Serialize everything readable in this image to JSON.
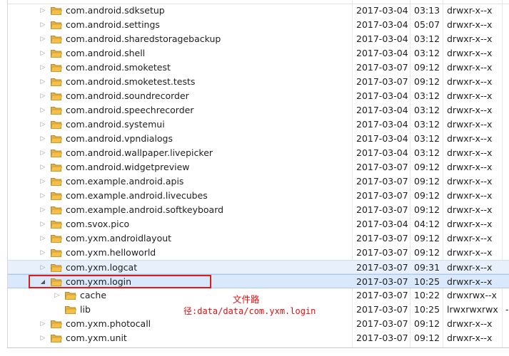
{
  "rows": [
    {
      "name": "com.android.sdksetup",
      "date": "2017-03-04",
      "time": "03:13",
      "perm": "drwxr-x--x"
    },
    {
      "name": "com.android.settings",
      "date": "2017-03-04",
      "time": "05:07",
      "perm": "drwxr-x--x"
    },
    {
      "name": "com.android.sharedstoragebackup",
      "date": "2017-03-04",
      "time": "03:12",
      "perm": "drwxr-x--x"
    },
    {
      "name": "com.android.shell",
      "date": "2017-03-04",
      "time": "03:12",
      "perm": "drwxr-x--x"
    },
    {
      "name": "com.android.smoketest",
      "date": "2017-03-07",
      "time": "09:12",
      "perm": "drwxr-x--x"
    },
    {
      "name": "com.android.smoketest.tests",
      "date": "2017-03-07",
      "time": "09:12",
      "perm": "drwxr-x--x"
    },
    {
      "name": "com.android.soundrecorder",
      "date": "2017-03-04",
      "time": "03:12",
      "perm": "drwxr-x--x"
    },
    {
      "name": "com.android.speechrecorder",
      "date": "2017-03-04",
      "time": "03:12",
      "perm": "drwxr-x--x"
    },
    {
      "name": "com.android.systemui",
      "date": "2017-03-04",
      "time": "03:12",
      "perm": "drwxr-x--x"
    },
    {
      "name": "com.android.vpndialogs",
      "date": "2017-03-04",
      "time": "03:12",
      "perm": "drwxr-x--x"
    },
    {
      "name": "com.android.wallpaper.livepicker",
      "date": "2017-03-04",
      "time": "03:12",
      "perm": "drwxr-x--x"
    },
    {
      "name": "com.android.widgetpreview",
      "date": "2017-03-07",
      "time": "09:12",
      "perm": "drwxr-x--x"
    },
    {
      "name": "com.example.android.apis",
      "date": "2017-03-07",
      "time": "09:12",
      "perm": "drwxr-x--x"
    },
    {
      "name": "com.example.android.livecubes",
      "date": "2017-03-07",
      "time": "09:12",
      "perm": "drwxr-x--x"
    },
    {
      "name": "com.example.android.softkeyboard",
      "date": "2017-03-07",
      "time": "09:12",
      "perm": "drwxr-x--x"
    },
    {
      "name": "com.svox.pico",
      "date": "2017-03-04",
      "time": "04:12",
      "perm": "drwxr-x--x"
    },
    {
      "name": "com.yxm.androidlayout",
      "date": "2017-03-07",
      "time": "09:12",
      "perm": "drwxr-x--x"
    },
    {
      "name": "com.yxm.helloworld",
      "date": "2017-03-07",
      "time": "09:12",
      "perm": "drwxr-x--x"
    },
    {
      "name": "com.yxm.logcat",
      "date": "2017-03-07",
      "time": "09:31",
      "perm": "drwxr-x--x"
    },
    {
      "name": "com.yxm.login",
      "date": "2017-03-07",
      "time": "10:25",
      "perm": "drwxr-x--x"
    },
    {
      "name": "cache",
      "date": "2017-03-07",
      "time": "10:22",
      "perm": "drwxrwx--x"
    },
    {
      "name": "lib",
      "date": "2017-03-07",
      "time": "10:25",
      "perm": "lrwxrwxrwx",
      "extra": "-"
    },
    {
      "name": "com.yxm.photocall",
      "date": "2017-03-07",
      "time": "09:12",
      "perm": "drwxr-x--x"
    },
    {
      "name": "com.yxm.unit",
      "date": "2017-03-07",
      "time": "09:12",
      "perm": "drwxr-x--x"
    }
  ],
  "annotation": {
    "line1": "文件路",
    "line2": "径:data/data/com.yxm.login"
  },
  "icons": {
    "collapsed_arrow": "triangle-right-icon",
    "expanded_arrow": "triangle-down-icon",
    "folder": "folder-icon"
  },
  "colors": {
    "highlight_box": "#e21a1a",
    "annotation_text": "#e01010",
    "selection": "#d9e8fa",
    "hover": "#e8f1fb",
    "folder": "#f2c04b"
  }
}
